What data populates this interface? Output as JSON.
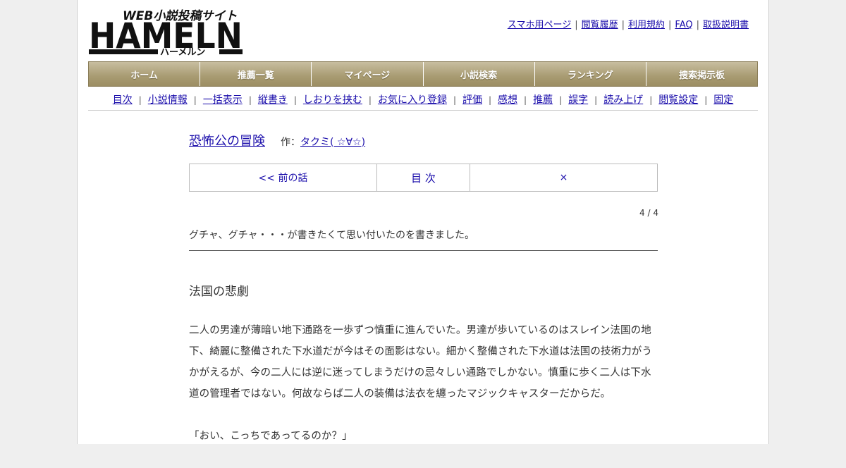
{
  "logo": {
    "tagline": "WEB小説投稿サイト",
    "wordmark": "HAMELN",
    "kana": "ハーメルン"
  },
  "top_links": [
    "スマホ用ページ",
    "閲覧履歴",
    "利用規約",
    "FAQ",
    "取扱説明書"
  ],
  "main_nav": [
    "ホーム",
    "推薦一覧",
    "マイページ",
    "小説検索",
    "ランキング",
    "捜索掲示板"
  ],
  "sub_nav": [
    "目次",
    "小説情報",
    "一括表示",
    "縦書き",
    "しおりを挟む",
    "お気に入り登録",
    "評価",
    "感想",
    "推薦",
    "誤字",
    "読み上げ",
    "閲覧設定",
    "固定"
  ],
  "novel": {
    "title": "恐怖公の冒険",
    "author_prefix": "作：",
    "author": "タクミ( ☆∀☆)"
  },
  "pager": {
    "prev": "<< 前の話",
    "toc": "目 次",
    "next": "×"
  },
  "progress": "4 / 4",
  "foreword": "グチャ、グチャ・・・が書きたくて思い付いたのを書きました。",
  "chapter_title": "法国の悲劇",
  "paragraphs": [
    "二人の男達が薄暗い地下通路を一歩ずつ慎重に進んでいた。男達が歩いているのはスレイン法国の地下、綺麗に整備された下水道だが今はその面影はない。細かく整備された下水道は法国の技術力がうかがえるが、今の二人には逆に迷ってしまうだけの忌々しい通路でしかない。慎重に歩く二人は下水道の管理者ではない。何故ならば二人の装備は法衣を纏ったマジックキャスターだからだ。",
    "「おい、こっちであってるのか？」"
  ]
}
